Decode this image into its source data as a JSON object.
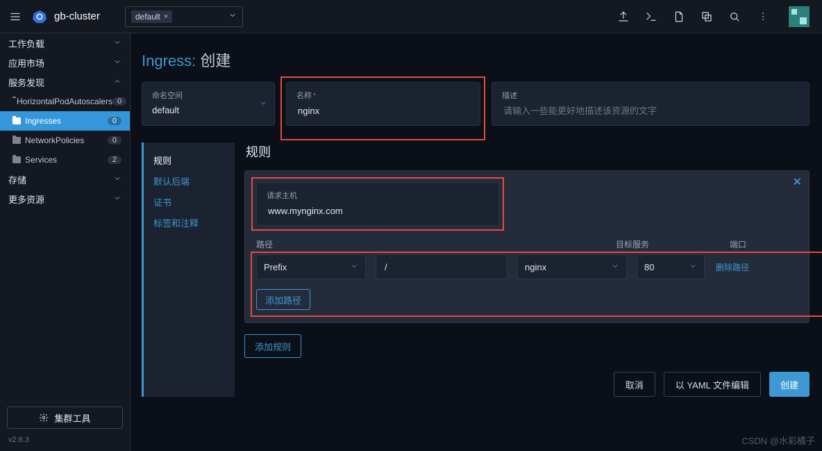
{
  "header": {
    "cluster": "gb-cluster",
    "namespace_chip": "default",
    "namespace_close": "×"
  },
  "sidebar": {
    "groups": [
      {
        "label": "工作负载",
        "dir": "down"
      },
      {
        "label": "应用市场",
        "dir": "down"
      },
      {
        "label": "服务发现",
        "dir": "up"
      }
    ],
    "svc_items": [
      {
        "label": "HorizontalPodAutoscalers",
        "count": "0"
      },
      {
        "label": "Ingresses",
        "count": "0",
        "active": true
      },
      {
        "label": "NetworkPolicies",
        "count": "0"
      },
      {
        "label": "Services",
        "count": "2"
      }
    ],
    "tail": [
      {
        "label": "存储",
        "dir": "down"
      },
      {
        "label": "更多资源",
        "dir": "down"
      }
    ],
    "tools": "集群工具",
    "version": "v2.6.3"
  },
  "page": {
    "title_prefix": "Ingress:",
    "title_action": "创建",
    "ns_label": "命名空间",
    "ns_value": "default",
    "name_label": "名称",
    "name_value": "nginx",
    "desc_label": "描述",
    "desc_placeholder": "请输入一些能更好地描述该资源的文字"
  },
  "leftnav": [
    "规则",
    "默认后端",
    "证书",
    "标签和注释"
  ],
  "rules": {
    "title": "规则",
    "host_label": "请求主机",
    "host_value": "www.mynginx.com",
    "cols": {
      "path": "路径",
      "svc": "目标服务",
      "port": "端口"
    },
    "row": {
      "type": "Prefix",
      "path": "/",
      "svc": "nginx",
      "port": "80"
    },
    "del": "删除路径",
    "add_path": "添加路径",
    "add_rule": "添加规则"
  },
  "footer": {
    "cancel": "取消",
    "yaml": "以 YAML 文件编辑",
    "create": "创建"
  },
  "watermark": "CSDN @水彩橘子"
}
